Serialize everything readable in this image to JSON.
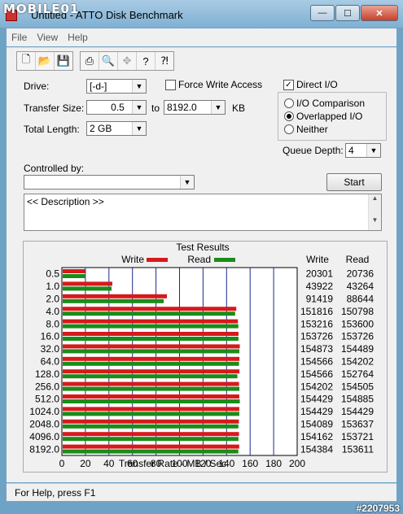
{
  "watermark": "MOBILE01",
  "window": {
    "title": "Untitled - ATTO Disk Benchmark",
    "min": "—",
    "max": "☐",
    "close": "✕"
  },
  "menu": [
    "File",
    "View",
    "Help"
  ],
  "toolbar_icons": [
    "new-icon",
    "open-icon",
    "save-icon",
    "print-icon",
    "print-preview-icon",
    "move-icon",
    "help-icon",
    "context-help-icon"
  ],
  "form": {
    "drive_label": "Drive:",
    "drive_value": "[-d-]",
    "transfer_size_label": "Transfer Size:",
    "transfer_from": "0.5",
    "to_label": "to",
    "transfer_to": "8192.0",
    "kb_label": "KB",
    "total_length_label": "Total Length:",
    "total_length_value": "2 GB",
    "force_write": "Force Write Access",
    "direct_io": "Direct I/O",
    "io_comparison": "I/O Comparison",
    "overlapped_io": "Overlapped I/O",
    "neither": "Neither",
    "queue_depth_label": "Queue Depth:",
    "queue_depth_value": "4",
    "controlled_by_label": "Controlled by:",
    "controlled_by_value": "",
    "start": "Start",
    "description": "<< Description >>"
  },
  "status": "For Help, press F1",
  "image_id": "#2207953",
  "colors": {
    "write": "#d7191c",
    "read": "#1a8c1a"
  },
  "chart_data": {
    "type": "bar",
    "title": "Test Results",
    "xlabel": "Transfer Rate - MB / Sec",
    "xlim": [
      0,
      200
    ],
    "xticks": [
      0,
      20,
      40,
      60,
      80,
      100,
      120,
      140,
      160,
      180,
      200
    ],
    "categories": [
      "0.5",
      "1.0",
      "2.0",
      "4.0",
      "8.0",
      "16.0",
      "32.0",
      "64.0",
      "128.0",
      "256.0",
      "512.0",
      "1024.0",
      "2048.0",
      "4096.0",
      "8192.0"
    ],
    "col_headers": [
      "Write",
      "Read"
    ],
    "series": [
      {
        "name": "Write",
        "values": [
          20301,
          43922,
          91419,
          151816,
          153216,
          153726,
          154873,
          154566,
          154566,
          154202,
          154429,
          154429,
          154089,
          154162,
          154384
        ]
      },
      {
        "name": "Read",
        "values": [
          20736,
          43264,
          88644,
          150798,
          153600,
          153726,
          154489,
          154202,
          152764,
          154505,
          154885,
          154429,
          153637,
          153721,
          153611
        ]
      }
    ]
  }
}
